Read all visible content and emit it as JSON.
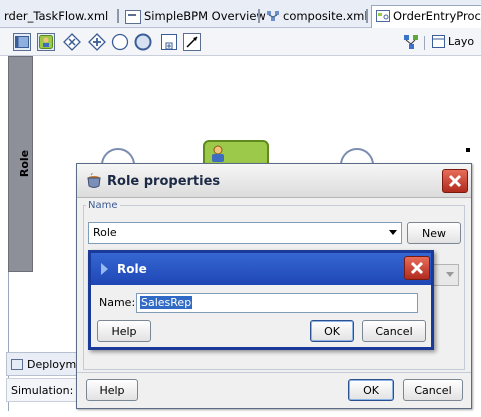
{
  "tabs": [
    {
      "label": "rder_TaskFlow.xml",
      "selected": false
    },
    {
      "label": "SimpleBPM Overview",
      "selected": false
    },
    {
      "label": "composite.xml",
      "selected": false
    },
    {
      "label": "OrderEntryProce",
      "selected": true
    }
  ],
  "toolbar": {
    "layout_label": "Layo"
  },
  "lane": {
    "label": "Role"
  },
  "role_properties": {
    "title": "Role properties",
    "group_label": "Name",
    "role_select_value": "Role",
    "new_button": "New",
    "help_button": "Help",
    "ok_button": "OK",
    "cancel_button": "Cancel"
  },
  "role_dialog": {
    "title": "Role",
    "name_label": "Name:",
    "name_value": "SalesRep",
    "help_button": "Help",
    "ok_button": "OK",
    "cancel_button": "Cancel"
  },
  "bottom_panel": {
    "deployment_tab": "Deployme",
    "simulation_label": "Simulation:"
  },
  "colors": {
    "title_blue": "#1e46b4",
    "close_red": "#b02b1e",
    "lane_gray": "#8e9099",
    "task_green": "#9dc94a"
  }
}
